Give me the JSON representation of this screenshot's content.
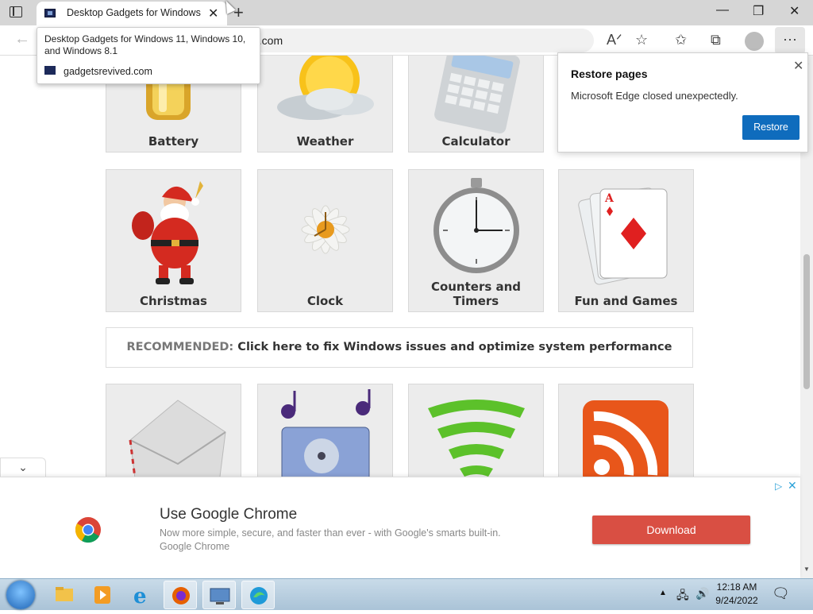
{
  "browser": {
    "tab_title": "Desktop Gadgets for Windows 11, Windows 10, and Windows 8.1",
    "address_visible": "d.com",
    "tooltip": {
      "title": "Desktop Gadgets for Windows 11, Windows 10, and Windows 8.1",
      "url": "gadgetsrevived.com"
    }
  },
  "tiles_row1": [
    {
      "label": "Battery"
    },
    {
      "label": "Weather"
    },
    {
      "label": "Calculator"
    }
  ],
  "tiles_row2": [
    {
      "label": "Christmas"
    },
    {
      "label": "Clock"
    },
    {
      "label": "Counters and Timers"
    },
    {
      "label": "Fun and Games"
    }
  ],
  "recommended": {
    "prefix": "RECOMMENDED:",
    "text": "Click here to fix Windows issues and optimize system performance"
  },
  "restore_popup": {
    "title": "Restore pages",
    "message": "Microsoft Edge closed unexpectedly.",
    "button": "Restore"
  },
  "ad": {
    "title": "Use Google Chrome",
    "subtitle": "Now more simple, secure, and faster than ever - with Google's smarts built-in.",
    "brand": "Google Chrome",
    "button": "Download"
  },
  "taskbar": {
    "time": "12:18 AM",
    "date": "9/24/2022"
  },
  "colors": {
    "restore_button": "#0f6cbd",
    "ad_button": "#d94f43",
    "tile_bg": "#ececec"
  }
}
